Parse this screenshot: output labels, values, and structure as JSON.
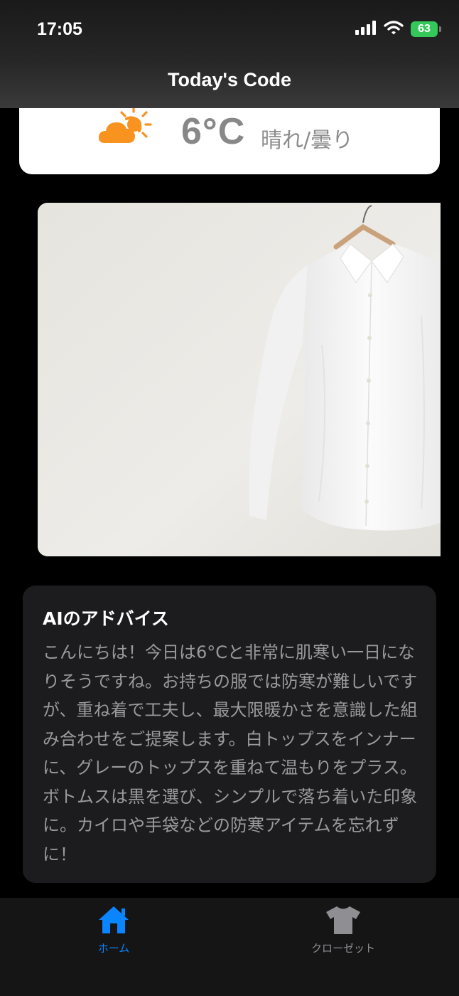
{
  "status_bar": {
    "time": "17:05",
    "battery": "63"
  },
  "nav": {
    "title": "Today's Code"
  },
  "weather": {
    "icon": "partly-cloudy-sun-icon",
    "temperature": "6°C",
    "condition": "晴れ/曇り"
  },
  "outfit": {
    "image": "white-shirt-on-hanger"
  },
  "advice": {
    "title": "AIのアドバイス",
    "body": "こんにちは！今日は6°Cと非常に肌寒い一日になりそうですね。お持ちの服では防寒が難しいですが、重ね着で工夫し、最大限暖かさを意識した組み合わせをご提案します。白トップスをインナーに、グレーのトップスを重ねて温もりをプラス。ボトムスは黒を選び、シンプルで落ち着いた印象に。カイロや手袋などの防寒アイテムを忘れずに！"
  },
  "tabs": [
    {
      "label": "ホーム",
      "icon": "house-icon",
      "active": true
    },
    {
      "label": "クローゼット",
      "icon": "tshirt-icon",
      "active": false
    }
  ],
  "colors": {
    "accent": "#0a84ff",
    "weather_icon": "#f7931e",
    "battery": "#34c759"
  }
}
